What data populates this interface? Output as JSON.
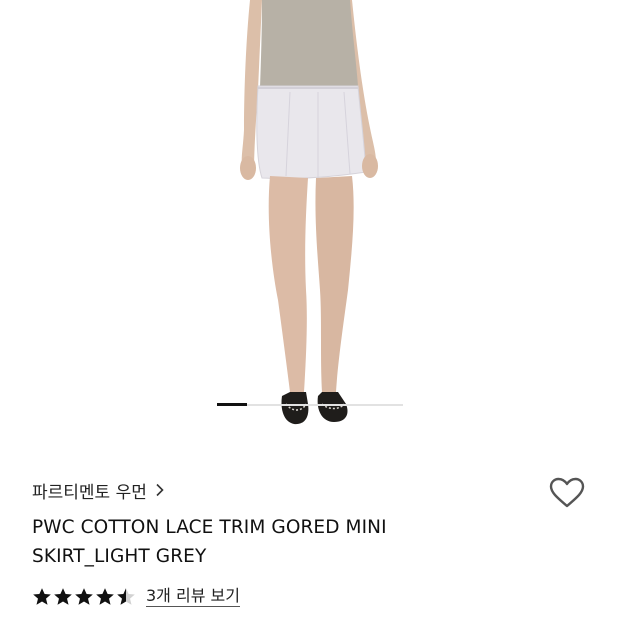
{
  "product": {
    "brand": "파르티멘토 우먼",
    "title_line1": "PWC COTTON LACE TRIM GORED MINI",
    "title_line2": "SKIRT_LIGHT GREY",
    "rating": 4.5,
    "review_link": "3개 리뷰 보기"
  },
  "gallery": {
    "progress": 0.16
  },
  "colors": {
    "text": "#111111",
    "star": "#111111",
    "heart_outline": "#555555",
    "track": "#e2e2e2"
  },
  "icons": [
    "chevron-right-icon",
    "heart-outline-icon",
    "star-icon"
  ]
}
